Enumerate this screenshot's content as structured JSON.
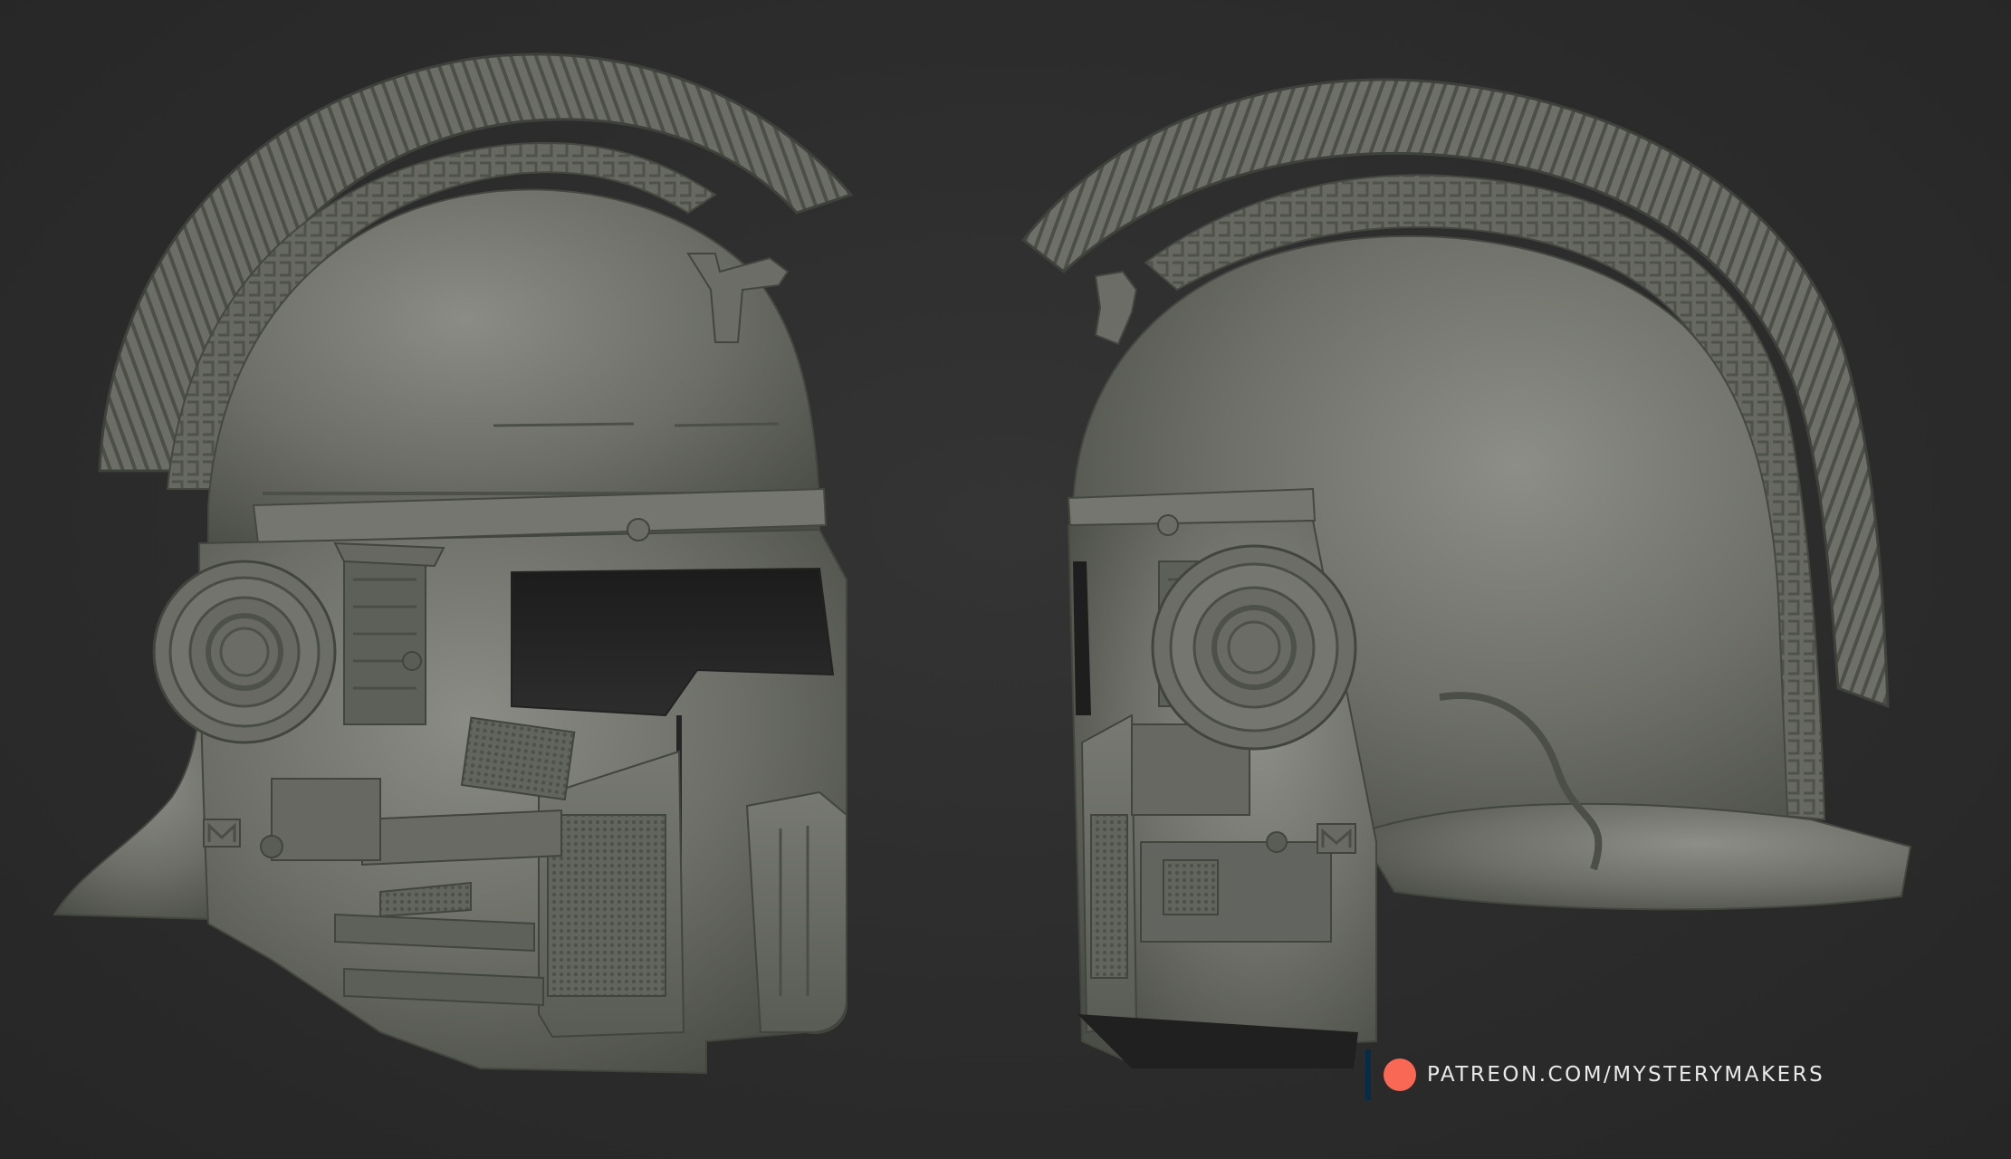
{
  "watermark": {
    "text": "PATREON.COM/MYSTERYMAKERS",
    "logo_icon": "patreon-logo-icon"
  },
  "colors": {
    "background": "#2b2b2b",
    "helmet_clay": "#6f716a",
    "patreon_coral": "#f96854",
    "patreon_navy": "#052d49",
    "text": "#e9e9e9"
  },
  "views": [
    {
      "name": "helmet-left-profile"
    },
    {
      "name": "helmet-right-profile"
    }
  ]
}
